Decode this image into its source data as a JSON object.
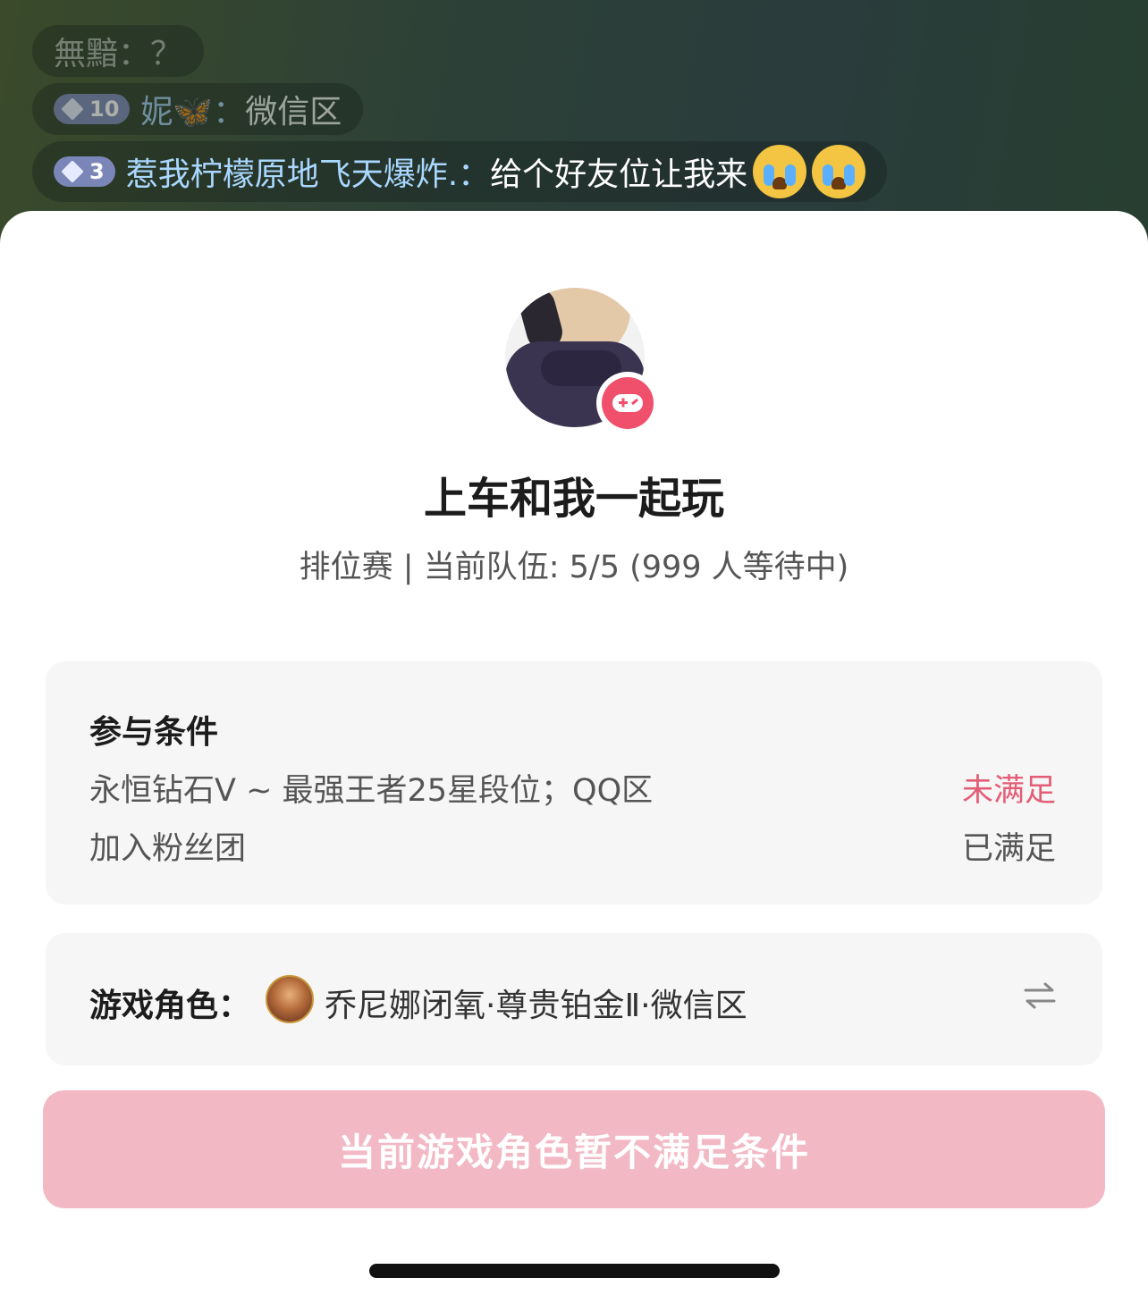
{
  "chat": {
    "messages": [
      {
        "badge": "",
        "name": "無黯：",
        "text": "？"
      },
      {
        "badge": "10",
        "name": "妮🦋：",
        "text": "微信区"
      },
      {
        "badge": "3",
        "name": "惹我柠檬原地飞天爆炸.：",
        "text": "给个好友位让我来"
      }
    ]
  },
  "sheet": {
    "title": "上车和我一起玩",
    "subtitle": "排位赛 | 当前队伍: 5/5 (999 人等待中)",
    "conditions": {
      "heading": "参与条件",
      "items": [
        {
          "label": "永恒钻石Ⅴ ~ 最强王者25星段位；QQ区",
          "status": "未满足"
        },
        {
          "label": "加入粉丝团",
          "status": "已满足"
        }
      ]
    },
    "role": {
      "label": "游戏角色：",
      "value": "乔尼娜闭氧·尊贵铂金Ⅱ·微信区",
      "icon": "game-character-avatar",
      "switch_icon": "swap-icon"
    },
    "cta_label": "当前游戏角色暂不满足条件"
  },
  "colors": {
    "accent_unmet": "#e45d77",
    "cta_bg": "#f2b9c5",
    "badge_bg": "#7b86b8",
    "game_badge": "#f0506b"
  }
}
